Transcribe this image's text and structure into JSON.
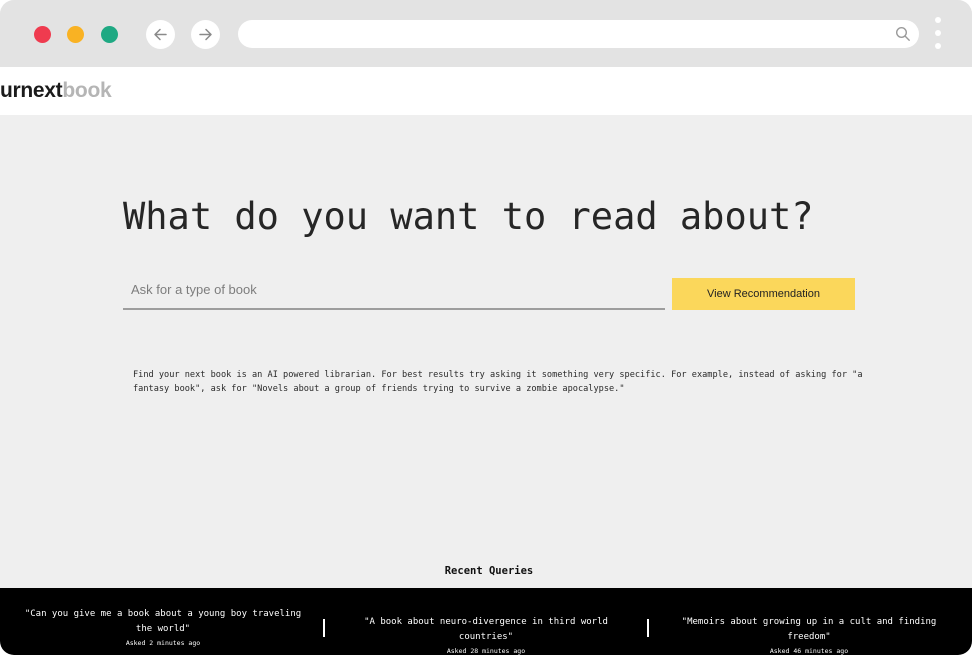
{
  "browser": {
    "icons": {
      "back": "arrow-left-icon",
      "forward": "arrow-right-icon",
      "search": "search-icon",
      "menu": "kebab-menu-icon"
    },
    "window_dot_colors": [
      "#ef3b4f",
      "#f9b223",
      "#1fa983"
    ]
  },
  "header": {
    "logo_dark": "urnext",
    "logo_light": "book"
  },
  "main": {
    "heading": "What do you want to read about?",
    "search": {
      "placeholder": "Ask for a type of book",
      "value": ""
    },
    "view_button_label": "View Recommendation",
    "description": "Find your next book is an AI powered librarian. For best results try asking it something very specific. For example, instead of asking for \"a fantasy book\", ask for \"Novels about a group of friends trying to survive a zombie apocalypse.\"",
    "recent_title": "Recent Queries"
  },
  "recent_queries": [
    {
      "text": "\"Can you give me a book about a young boy traveling the world\"",
      "time": "Asked 2 minutes ago"
    },
    {
      "text": "\"A book about neuro-divergence in third world countries\"",
      "time": "Asked 28 minutes ago"
    },
    {
      "text": "\"Memoirs about growing up in a cult and finding freedom\"",
      "time": "Asked 46 minutes ago"
    }
  ],
  "colors": {
    "accent_button": "#fbd75b",
    "footer_background": "#000000",
    "page_background": "#efefef"
  }
}
